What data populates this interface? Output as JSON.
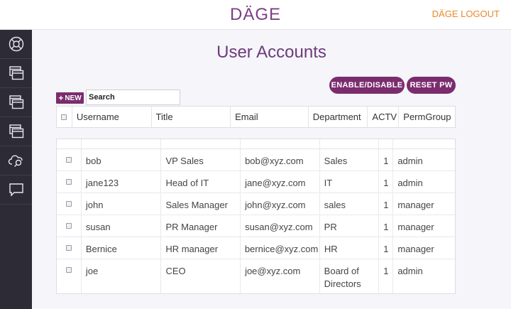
{
  "header": {
    "brand": "DÄGE",
    "logout": "DÄGE LOGOUT"
  },
  "sidebar": {
    "items": [
      {
        "icon": "lifebuoy-icon"
      },
      {
        "icon": "window-icon"
      },
      {
        "icon": "window-icon"
      },
      {
        "icon": "window-icon"
      },
      {
        "icon": "cloud-search-icon"
      },
      {
        "icon": "chat-bubble-icon"
      }
    ]
  },
  "main": {
    "title": "User Accounts",
    "enable_disable_label": "ENABLE/DISABLE",
    "reset_pw_label": "RESET PW",
    "new_label": "NEW",
    "search": {
      "value": "",
      "placeholder": "Search"
    }
  },
  "table": {
    "columns": [
      "Username",
      "Title",
      "Email",
      "Department",
      "ACTV",
      "PermGroup"
    ],
    "rows": [
      {
        "username": "bob",
        "title": "VP Sales",
        "email": "bob@xyz.com",
        "department": "Sales",
        "actv": "1",
        "permgroup": "admin"
      },
      {
        "username": "jane123",
        "title": "Head of IT",
        "email": "jane@xyz.com",
        "department": "IT",
        "actv": "1",
        "permgroup": "admin"
      },
      {
        "username": "john",
        "title": "Sales Manager",
        "email": "john@xyz.com",
        "department": "sales",
        "actv": "1",
        "permgroup": "manager"
      },
      {
        "username": "susan",
        "title": "PR Manager",
        "email": "susan@xyz.com",
        "department": "PR",
        "actv": "1",
        "permgroup": "manager"
      },
      {
        "username": "Bernice",
        "title": "HR manager",
        "email": "bernice@xyz.com",
        "department": "HR",
        "actv": "1",
        "permgroup": "manager"
      },
      {
        "username": "joe",
        "title": "CEO",
        "email": "joe@xyz.com",
        "department": "Board of Directors",
        "actv": "1",
        "permgroup": "admin"
      }
    ]
  }
}
